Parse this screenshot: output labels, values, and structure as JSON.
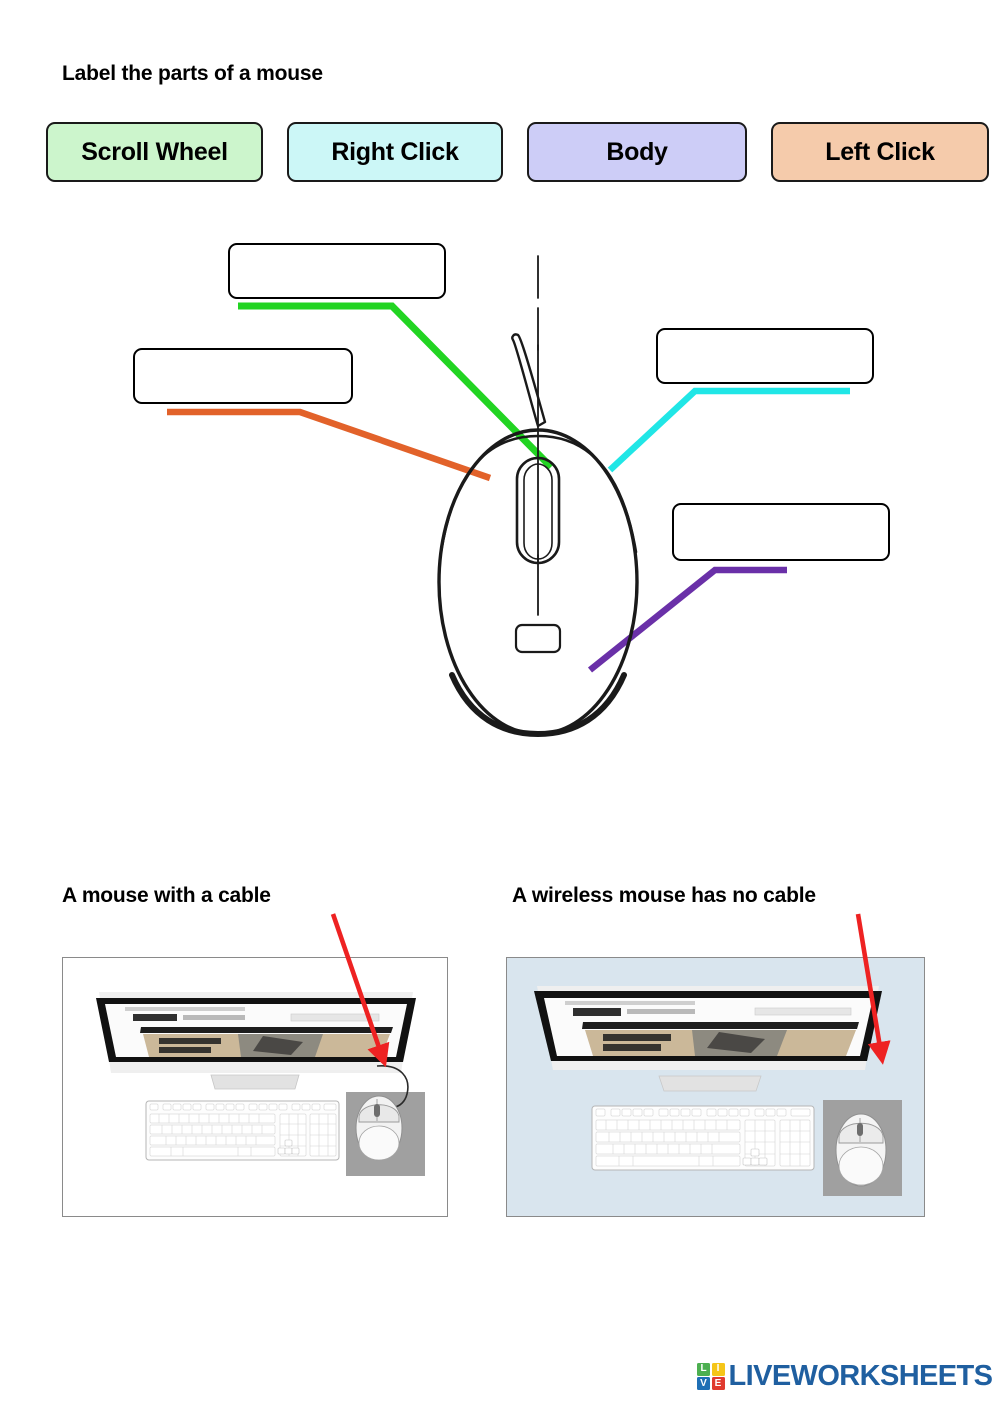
{
  "title": "Label the parts of a mouse",
  "word_bank": {
    "items": [
      {
        "label": "Scroll Wheel",
        "color": "#ccf5cc"
      },
      {
        "label": "Right Click",
        "color": "#ccf7f7"
      },
      {
        "label": "Body",
        "color": "#cdcdf7"
      },
      {
        "label": "Left Click",
        "color": "#f5cbab"
      }
    ]
  },
  "diagram": {
    "image": "computer-mouse-line-drawing",
    "answer_boxes": [
      {
        "name": "answer-box-scroll-wheel",
        "value": "",
        "placeholder": "",
        "connector_color": "#22d422"
      },
      {
        "name": "answer-box-left-click",
        "value": "",
        "placeholder": "",
        "connector_color": "#e2622a"
      },
      {
        "name": "answer-box-right-click",
        "value": "",
        "placeholder": "",
        "connector_color": "#20e6e6"
      },
      {
        "name": "answer-box-body",
        "value": "",
        "placeholder": "",
        "connector_color": "#6a30a8"
      }
    ]
  },
  "comparison": {
    "left": {
      "heading": "A mouse with a cable",
      "photo": "desktop-computer-with-corded-mouse",
      "background_color": "#ffffff",
      "arrow_color": "#ee2222"
    },
    "right": {
      "heading": "A wireless mouse has no cable",
      "photo": "desktop-computer-with-wireless-mouse",
      "background_color": "#d9e5ee",
      "arrow_color": "#ee2222"
    }
  },
  "footer": {
    "logo_tiles": [
      "L",
      "I",
      "V",
      "E"
    ],
    "wordmark": "LIVEWORKSHEETS",
    "wordmark_color": "#1f5fa0"
  }
}
